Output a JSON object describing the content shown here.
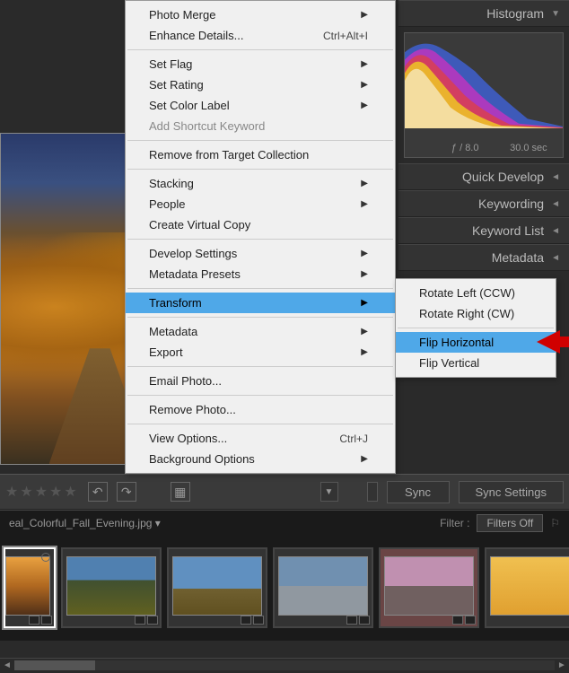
{
  "panels": {
    "histogram": {
      "label": "Histogram",
      "info": {
        "iso": "",
        "aperture": "ƒ / 8.0",
        "shutter": "30.0 sec"
      }
    },
    "quick_develop": "Quick Develop",
    "keywording": "Keywording",
    "keyword_list": "Keyword List",
    "metadata": "Metadata"
  },
  "context_menu": {
    "photo_merge": "Photo Merge",
    "enhance_details": "Enhance Details...",
    "enhance_details_shortcut": "Ctrl+Alt+I",
    "set_flag": "Set Flag",
    "set_rating": "Set Rating",
    "set_color_label": "Set Color Label",
    "add_shortcut_keyword": "Add Shortcut Keyword",
    "remove_from_target": "Remove from Target Collection",
    "stacking": "Stacking",
    "people": "People",
    "create_virtual_copy": "Create Virtual Copy",
    "develop_settings": "Develop Settings",
    "metadata_presets": "Metadata Presets",
    "transform": "Transform",
    "metadata": "Metadata",
    "export": "Export",
    "email_photo": "Email Photo...",
    "remove_photo": "Remove Photo...",
    "view_options": "View Options...",
    "view_options_shortcut": "Ctrl+J",
    "background_options": "Background Options"
  },
  "submenu": {
    "rotate_left": "Rotate Left (CCW)",
    "rotate_right": "Rotate Right (CW)",
    "flip_horizontal": "Flip Horizontal",
    "flip_vertical": "Flip Vertical"
  },
  "toolbar": {
    "sync": "Sync",
    "sync_settings": "Sync Settings"
  },
  "filter": {
    "filename": "eal_Colorful_Fall_Evening.jpg  ▾",
    "label": "Filter :",
    "value": "Filters Off"
  }
}
